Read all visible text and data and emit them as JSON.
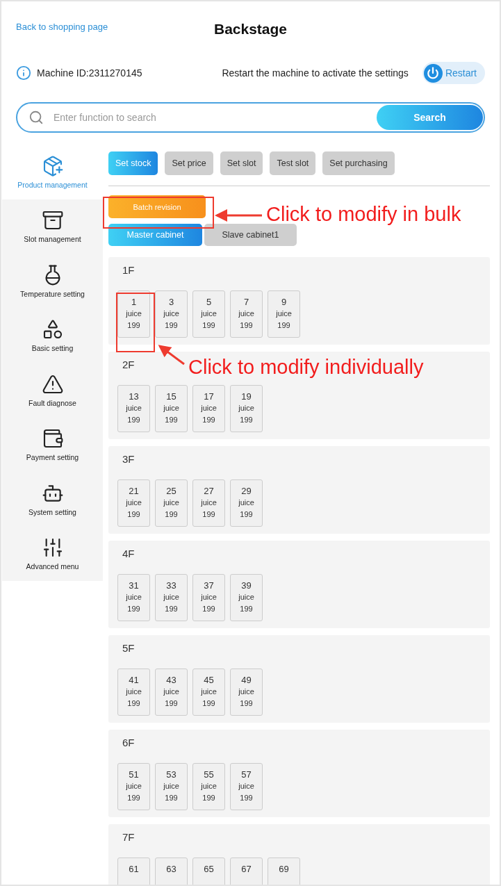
{
  "header": {
    "back_link": "Back to shopping page",
    "title": "Backstage"
  },
  "machine": {
    "id_label": "Machine ID:2311270145",
    "hint": "Restart the machine to activate the settings",
    "restart_button": "Restart"
  },
  "search": {
    "placeholder": "Enter function to search",
    "button": "Search"
  },
  "sidebar": {
    "items": [
      {
        "label": "Product management",
        "selected": true
      },
      {
        "label": "Slot management",
        "selected": false
      },
      {
        "label": "Temperature setting",
        "selected": false
      },
      {
        "label": "Basic setting",
        "selected": false
      },
      {
        "label": "Fault diagnose",
        "selected": false
      },
      {
        "label": "Payment setting",
        "selected": false
      },
      {
        "label": "System setting",
        "selected": false
      },
      {
        "label": "Advanced menu",
        "selected": false
      }
    ]
  },
  "tabs": [
    {
      "label": "Set stock",
      "selected": true
    },
    {
      "label": "Set price",
      "selected": false
    },
    {
      "label": "Set slot",
      "selected": false
    },
    {
      "label": "Test slot",
      "selected": false
    },
    {
      "label": "Set purchasing",
      "selected": false
    }
  ],
  "batch_button": "Batch revision",
  "cabinets": [
    {
      "label": "Master cabinet",
      "selected": true
    },
    {
      "label": "Slave cabinet1",
      "selected": false
    }
  ],
  "floors": [
    {
      "label": "1F",
      "slots": [
        {
          "number": "1",
          "name": "juice",
          "count": "199"
        },
        {
          "number": "3",
          "name": "juice",
          "count": "199"
        },
        {
          "number": "5",
          "name": "juice",
          "count": "199"
        },
        {
          "number": "7",
          "name": "juice",
          "count": "199"
        },
        {
          "number": "9",
          "name": "juice",
          "count": "199"
        }
      ]
    },
    {
      "label": "2F",
      "slots": [
        {
          "number": "13",
          "name": "juice",
          "count": "199"
        },
        {
          "number": "15",
          "name": "juice",
          "count": "199"
        },
        {
          "number": "17",
          "name": "juice",
          "count": "199"
        },
        {
          "number": "19",
          "name": "juice",
          "count": "199"
        }
      ]
    },
    {
      "label": "3F",
      "slots": [
        {
          "number": "21",
          "name": "juice",
          "count": "199"
        },
        {
          "number": "25",
          "name": "juice",
          "count": "199"
        },
        {
          "number": "27",
          "name": "juice",
          "count": "199"
        },
        {
          "number": "29",
          "name": "juice",
          "count": "199"
        }
      ]
    },
    {
      "label": "4F",
      "slots": [
        {
          "number": "31",
          "name": "juice",
          "count": "199"
        },
        {
          "number": "33",
          "name": "juice",
          "count": "199"
        },
        {
          "number": "37",
          "name": "juice",
          "count": "199"
        },
        {
          "number": "39",
          "name": "juice",
          "count": "199"
        }
      ]
    },
    {
      "label": "5F",
      "slots": [
        {
          "number": "41",
          "name": "juice",
          "count": "199"
        },
        {
          "number": "43",
          "name": "juice",
          "count": "199"
        },
        {
          "number": "45",
          "name": "juice",
          "count": "199"
        },
        {
          "number": "49",
          "name": "juice",
          "count": "199"
        }
      ]
    },
    {
      "label": "6F",
      "slots": [
        {
          "number": "51",
          "name": "juice",
          "count": "199"
        },
        {
          "number": "53",
          "name": "juice",
          "count": "199"
        },
        {
          "number": "55",
          "name": "juice",
          "count": "199"
        },
        {
          "number": "57",
          "name": "juice",
          "count": "199"
        }
      ]
    },
    {
      "label": "7F",
      "slots": [
        {
          "number": "61"
        },
        {
          "number": "63"
        },
        {
          "number": "65"
        },
        {
          "number": "67"
        },
        {
          "number": "69"
        }
      ]
    }
  ],
  "annotations": [
    {
      "text": "Click to modify in bulk"
    },
    {
      "text": "Click to modify individually"
    }
  ]
}
